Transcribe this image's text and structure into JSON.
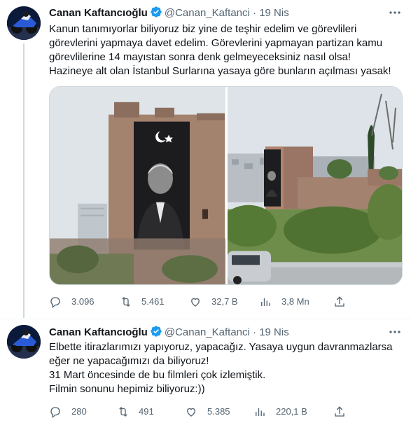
{
  "tweets": [
    {
      "author_name": "Canan Kaftancıoğlu",
      "handle": "@Canan_Kaftanci",
      "separator": "·",
      "date": "19 Nis",
      "lines": [
        "Kanun tanımıyorlar biliyoruz biz yine de teşhir edelim ve görevlileri",
        "görevlerini yapmaya davet edelim. Görevlerini yapmayan partizan kamu",
        "görevlilerine 14 mayıstan sonra denk gelmeyeceksiniz nasıl olsa!",
        "Hazineye alt olan İstanbul Surlarına yasaya göre bunların açılması yasak!"
      ],
      "stats": {
        "replies": "3.096",
        "retweets": "5.461",
        "likes": "32,7 B",
        "views": "3,8 Mn"
      }
    },
    {
      "author_name": "Canan Kaftancıoğlu",
      "handle": "@Canan_Kaftanci",
      "separator": "·",
      "date": "19 Nis",
      "lines": [
        "Elbette itirazlarımızı yapıyoruz, yapacağız. Yasaya uygun davranmazlarsa",
        "eğer ne yapacağımızı da biliyoruz!",
        "31 Mart öncesinde de bu filmleri çok izlemiştik.",
        "Filmin sonunu hepimiz biliyoruz:))"
      ],
      "stats": {
        "replies": "280",
        "retweets": "491",
        "likes": "5.385",
        "views": "220,1 B"
      }
    }
  ],
  "colors": {
    "verified": "#1d9bf0",
    "muted": "#536471",
    "text": "#0f1419",
    "thread_line": "#cfd9de"
  },
  "icons": [
    "verified-badge-icon",
    "more-icon",
    "reply-icon",
    "retweet-icon",
    "like-icon",
    "views-icon",
    "share-icon"
  ]
}
